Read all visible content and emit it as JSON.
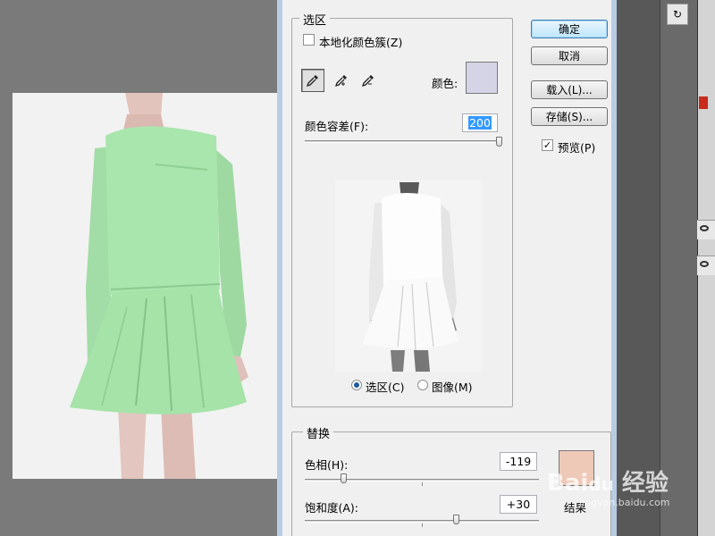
{
  "dialog": {
    "selection_group": {
      "title": "选区",
      "localized_clusters_label": "本地化颜色簇(Z)",
      "localized_clusters_checked": false,
      "color_label": "颜色:",
      "color_swatch": "#d4d4e6",
      "fuzziness_label": "颜色容差(F):",
      "fuzziness_value": "200",
      "fuzziness_max": 200,
      "radio_selection_label": "选区(C)",
      "radio_image_label": "图像(M)",
      "radio_selected": "selection",
      "tools": [
        "eyedropper-icon",
        "eyedropper-plus-icon",
        "eyedropper-minus-icon"
      ]
    },
    "buttons": {
      "ok": "确定",
      "cancel": "取消",
      "load": "载入(L)...",
      "save": "存储(S)..."
    },
    "preview_label": "预览(P)",
    "preview_checked": true,
    "replace_group": {
      "title": "替换",
      "hue_label": "色相(H):",
      "hue_value": "-119",
      "hue_min": -180,
      "hue_max": 180,
      "saturation_label": "饱和度(A):",
      "saturation_value": "+30",
      "saturation_min": -100,
      "saturation_max": 100,
      "result_label": "结果",
      "result_swatch": "#efc9b8"
    }
  },
  "colors": {
    "garment": "#a9e6ad",
    "dialog_frame": "#b8cde4"
  }
}
